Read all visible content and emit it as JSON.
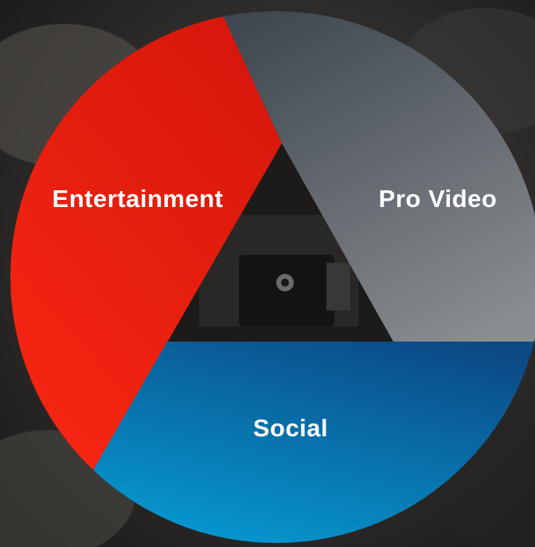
{
  "diagram": {
    "segments": [
      {
        "id": "entertainment",
        "label": "Entertainment",
        "color_from": "#ff2a14",
        "color_to": "#d8180c"
      },
      {
        "id": "pro-video",
        "label": "Pro Video",
        "color_from": "#3f4750",
        "color_to": "#8a8e91"
      },
      {
        "id": "social",
        "label": "Social",
        "color_from": "#05a8df",
        "color_to": "#0b4a86"
      }
    ],
    "background_color": "#2d2b29"
  }
}
